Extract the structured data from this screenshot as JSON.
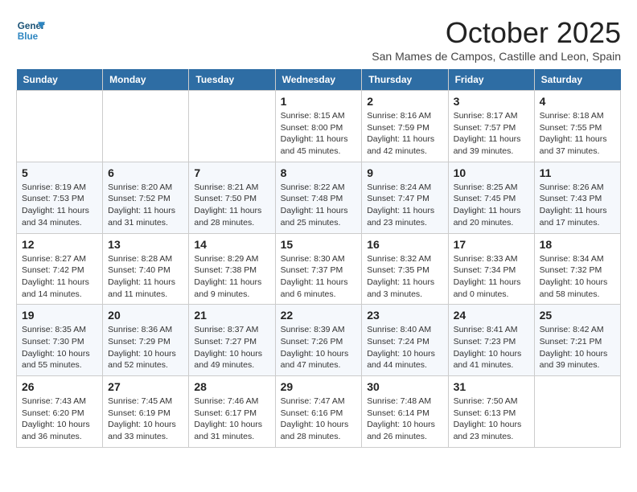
{
  "header": {
    "logo_line1": "General",
    "logo_line2": "Blue",
    "month": "October 2025",
    "location": "San Mames de Campos, Castille and Leon, Spain"
  },
  "weekdays": [
    "Sunday",
    "Monday",
    "Tuesday",
    "Wednesday",
    "Thursday",
    "Friday",
    "Saturday"
  ],
  "weeks": [
    [
      {
        "day": "",
        "detail": ""
      },
      {
        "day": "",
        "detail": ""
      },
      {
        "day": "",
        "detail": ""
      },
      {
        "day": "1",
        "detail": "Sunrise: 8:15 AM\nSunset: 8:00 PM\nDaylight: 11 hours and 45 minutes."
      },
      {
        "day": "2",
        "detail": "Sunrise: 8:16 AM\nSunset: 7:59 PM\nDaylight: 11 hours and 42 minutes."
      },
      {
        "day": "3",
        "detail": "Sunrise: 8:17 AM\nSunset: 7:57 PM\nDaylight: 11 hours and 39 minutes."
      },
      {
        "day": "4",
        "detail": "Sunrise: 8:18 AM\nSunset: 7:55 PM\nDaylight: 11 hours and 37 minutes."
      }
    ],
    [
      {
        "day": "5",
        "detail": "Sunrise: 8:19 AM\nSunset: 7:53 PM\nDaylight: 11 hours and 34 minutes."
      },
      {
        "day": "6",
        "detail": "Sunrise: 8:20 AM\nSunset: 7:52 PM\nDaylight: 11 hours and 31 minutes."
      },
      {
        "day": "7",
        "detail": "Sunrise: 8:21 AM\nSunset: 7:50 PM\nDaylight: 11 hours and 28 minutes."
      },
      {
        "day": "8",
        "detail": "Sunrise: 8:22 AM\nSunset: 7:48 PM\nDaylight: 11 hours and 25 minutes."
      },
      {
        "day": "9",
        "detail": "Sunrise: 8:24 AM\nSunset: 7:47 PM\nDaylight: 11 hours and 23 minutes."
      },
      {
        "day": "10",
        "detail": "Sunrise: 8:25 AM\nSunset: 7:45 PM\nDaylight: 11 hours and 20 minutes."
      },
      {
        "day": "11",
        "detail": "Sunrise: 8:26 AM\nSunset: 7:43 PM\nDaylight: 11 hours and 17 minutes."
      }
    ],
    [
      {
        "day": "12",
        "detail": "Sunrise: 8:27 AM\nSunset: 7:42 PM\nDaylight: 11 hours and 14 minutes."
      },
      {
        "day": "13",
        "detail": "Sunrise: 8:28 AM\nSunset: 7:40 PM\nDaylight: 11 hours and 11 minutes."
      },
      {
        "day": "14",
        "detail": "Sunrise: 8:29 AM\nSunset: 7:38 PM\nDaylight: 11 hours and 9 minutes."
      },
      {
        "day": "15",
        "detail": "Sunrise: 8:30 AM\nSunset: 7:37 PM\nDaylight: 11 hours and 6 minutes."
      },
      {
        "day": "16",
        "detail": "Sunrise: 8:32 AM\nSunset: 7:35 PM\nDaylight: 11 hours and 3 minutes."
      },
      {
        "day": "17",
        "detail": "Sunrise: 8:33 AM\nSunset: 7:34 PM\nDaylight: 11 hours and 0 minutes."
      },
      {
        "day": "18",
        "detail": "Sunrise: 8:34 AM\nSunset: 7:32 PM\nDaylight: 10 hours and 58 minutes."
      }
    ],
    [
      {
        "day": "19",
        "detail": "Sunrise: 8:35 AM\nSunset: 7:30 PM\nDaylight: 10 hours and 55 minutes."
      },
      {
        "day": "20",
        "detail": "Sunrise: 8:36 AM\nSunset: 7:29 PM\nDaylight: 10 hours and 52 minutes."
      },
      {
        "day": "21",
        "detail": "Sunrise: 8:37 AM\nSunset: 7:27 PM\nDaylight: 10 hours and 49 minutes."
      },
      {
        "day": "22",
        "detail": "Sunrise: 8:39 AM\nSunset: 7:26 PM\nDaylight: 10 hours and 47 minutes."
      },
      {
        "day": "23",
        "detail": "Sunrise: 8:40 AM\nSunset: 7:24 PM\nDaylight: 10 hours and 44 minutes."
      },
      {
        "day": "24",
        "detail": "Sunrise: 8:41 AM\nSunset: 7:23 PM\nDaylight: 10 hours and 41 minutes."
      },
      {
        "day": "25",
        "detail": "Sunrise: 8:42 AM\nSunset: 7:21 PM\nDaylight: 10 hours and 39 minutes."
      }
    ],
    [
      {
        "day": "26",
        "detail": "Sunrise: 7:43 AM\nSunset: 6:20 PM\nDaylight: 10 hours and 36 minutes."
      },
      {
        "day": "27",
        "detail": "Sunrise: 7:45 AM\nSunset: 6:19 PM\nDaylight: 10 hours and 33 minutes."
      },
      {
        "day": "28",
        "detail": "Sunrise: 7:46 AM\nSunset: 6:17 PM\nDaylight: 10 hours and 31 minutes."
      },
      {
        "day": "29",
        "detail": "Sunrise: 7:47 AM\nSunset: 6:16 PM\nDaylight: 10 hours and 28 minutes."
      },
      {
        "day": "30",
        "detail": "Sunrise: 7:48 AM\nSunset: 6:14 PM\nDaylight: 10 hours and 26 minutes."
      },
      {
        "day": "31",
        "detail": "Sunrise: 7:50 AM\nSunset: 6:13 PM\nDaylight: 10 hours and 23 minutes."
      },
      {
        "day": "",
        "detail": ""
      }
    ]
  ]
}
